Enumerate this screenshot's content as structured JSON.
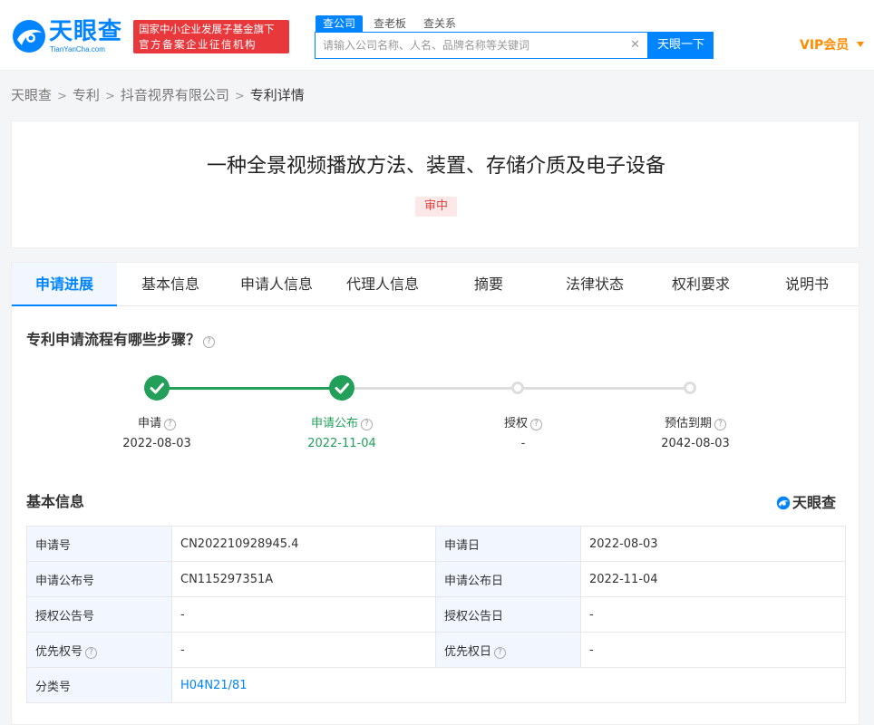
{
  "header": {
    "logo_cn": "天眼查",
    "logo_en": "TianYanCha.com",
    "gov_badge_line1": "国家中小企业发展子基金旗下",
    "gov_badge_line2": "官方备案企业征信机构",
    "search_tabs": [
      "查公司",
      "查老板",
      "查关系"
    ],
    "search_placeholder": "请输入公司名称、人名、品牌名称等关键词",
    "search_button": "天眼一下",
    "vip_label": "VIP会员"
  },
  "breadcrumb": [
    "天眼查",
    "专利",
    "抖音视界有限公司",
    "专利详情"
  ],
  "patent": {
    "title": "一种全景视频播放方法、装置、存储介质及电子设备",
    "status": "审中"
  },
  "tabs": [
    "申请进展",
    "基本信息",
    "申请人信息",
    "代理人信息",
    "摘要",
    "法律状态",
    "权利要求",
    "说明书"
  ],
  "progress": {
    "question": "专利申请流程有哪些步骤？",
    "steps": [
      {
        "label": "申请",
        "date": "2022-08-03",
        "state": "done"
      },
      {
        "label": "申请公布",
        "date": "2022-11-04",
        "state": "done"
      },
      {
        "label": "授权",
        "date": "-",
        "state": "todo"
      },
      {
        "label": "预估到期",
        "date": "2042-08-03",
        "state": "todo"
      }
    ]
  },
  "basic_info": {
    "title": "基本信息",
    "brand": "天眼查",
    "rows": [
      {
        "l1": "申请号",
        "v1": "CN202210928945.4",
        "l2": "申请日",
        "v2": "2022-08-03"
      },
      {
        "l1": "申请公布号",
        "v1": "CN115297351A",
        "l2": "申请公布日",
        "v2": "2022-11-04"
      },
      {
        "l1": "授权公告号",
        "v1": "-",
        "l2": "授权公告日",
        "v2": "-"
      },
      {
        "l1": "优先权号",
        "v1": "-",
        "l2": "优先权日",
        "v2": "-"
      }
    ],
    "class_label": "分类号",
    "class_value": "H04N21/81"
  },
  "colors": {
    "brand": "#0084ff",
    "done": "#22a05a",
    "status": "#e04646",
    "vip": "#ff8c00"
  }
}
